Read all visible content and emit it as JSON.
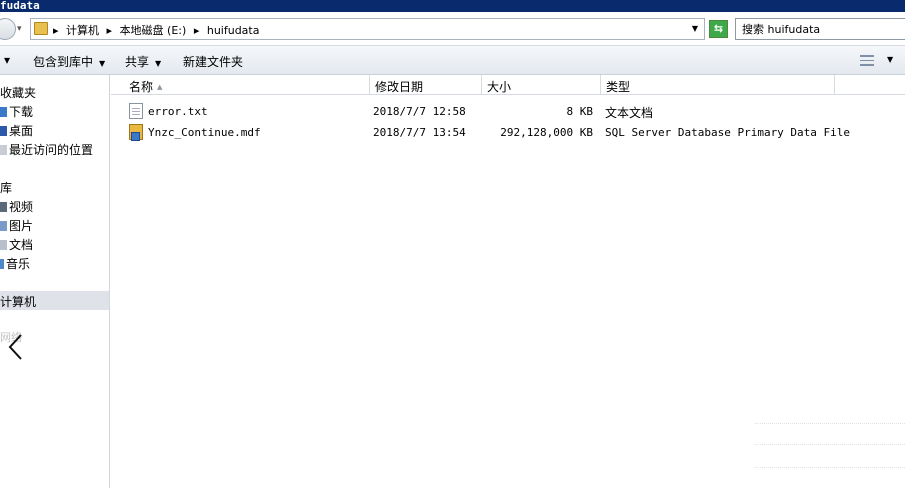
{
  "window": {
    "title": "fudata"
  },
  "address": {
    "crumbs": [
      "计算机",
      "本地磁盘 (E:)",
      "huifudata"
    ],
    "separator": "▸"
  },
  "search": {
    "value": "搜索 huifudata"
  },
  "toolbar": {
    "organize_caret": "▾",
    "include_library": "包含到库中",
    "share": "共享",
    "new_folder": "新建文件夹"
  },
  "sidebar": {
    "favorites": "收藏夹",
    "downloads": "下载",
    "desktop": "桌面",
    "recent": "最近访问的位置",
    "libraries": "库",
    "videos": "视频",
    "pictures": "图片",
    "documents": "文档",
    "music": "音乐",
    "computer": "计算机",
    "network": "网络"
  },
  "columns": {
    "name": "名称",
    "date": "修改日期",
    "size": "大小",
    "type": "类型"
  },
  "files": [
    {
      "name": "error.txt",
      "date": "2018/7/7 12:58",
      "size": "8 KB",
      "type": "文本文档",
      "icon": "text-file-icon"
    },
    {
      "name": "Ynzc_Continue.mdf",
      "date": "2018/7/7 13:54",
      "size": "292,128,000 KB",
      "type": "SQL Server Database Primary Data File",
      "icon": "database-file-icon"
    }
  ]
}
